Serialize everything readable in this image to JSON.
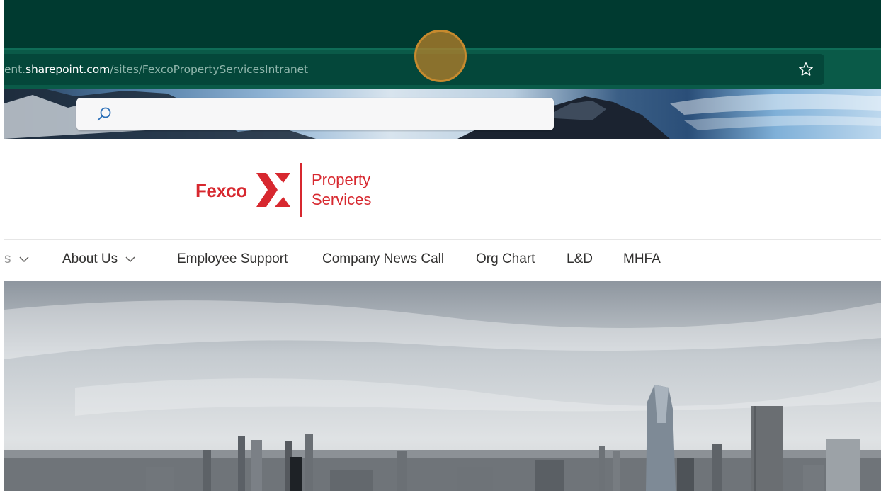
{
  "browser": {
    "url_prefix": "ent.",
    "url_host": "sharepoint.com",
    "url_path": "/sites/FexcoPropertyServicesIntranet"
  },
  "search": {
    "placeholder": ""
  },
  "logo": {
    "brand": "Fexco",
    "line1": "Property",
    "line2": "Services",
    "brand_color": "#d7282f"
  },
  "nav": {
    "items": [
      {
        "label": "s"
      },
      {
        "label": "About Us"
      },
      {
        "label": "Employee Support"
      },
      {
        "label": "Company News Call"
      },
      {
        "label": "Org Chart"
      },
      {
        "label": "L&D"
      },
      {
        "label": "MHFA"
      }
    ]
  },
  "colors": {
    "chrome_dark": "#003a30",
    "chrome_bar": "#0a5a48",
    "accent": "#d7282f"
  }
}
